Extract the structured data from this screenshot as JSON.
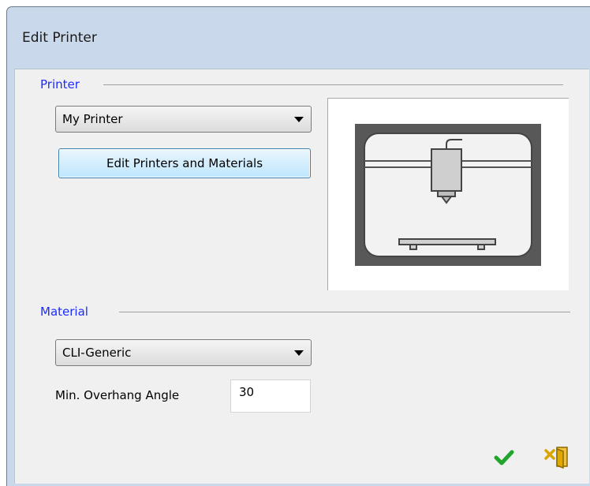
{
  "window": {
    "title": "Edit Printer"
  },
  "printer_group": {
    "label": "Printer",
    "selected_printer": "My Printer",
    "edit_button_label": "Edit Printers and Materials"
  },
  "material_group": {
    "label": "Material",
    "selected_material": "CLI-Generic",
    "overhang_label": "Min. Overhang Angle",
    "overhang_value": "30"
  },
  "actions": {
    "ok_icon": "checkmark-icon",
    "cancel_icon": "exit-door-icon"
  },
  "colors": {
    "group_label": "#1c2cff",
    "ok_green": "#22a52d",
    "cancel_gold": "#d9a400",
    "title_bar": "#c9d8ea"
  }
}
